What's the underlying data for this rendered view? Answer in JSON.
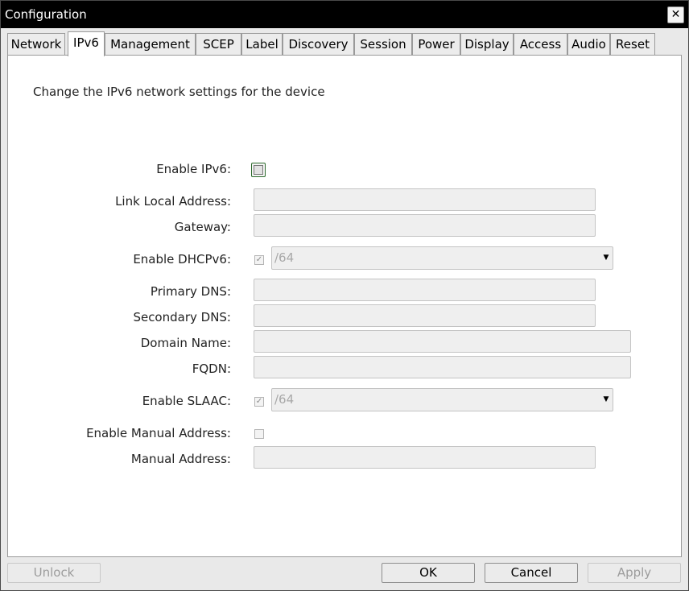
{
  "window": {
    "title": "Configuration",
    "close_glyph": "✕"
  },
  "tabs": [
    {
      "label": "Network"
    },
    {
      "label": "IPv6"
    },
    {
      "label": "Management"
    },
    {
      "label": "SCEP"
    },
    {
      "label": "Label"
    },
    {
      "label": "Discovery"
    },
    {
      "label": "Session"
    },
    {
      "label": "Power"
    },
    {
      "label": "Display"
    },
    {
      "label": "Access"
    },
    {
      "label": "Audio"
    },
    {
      "label": "Reset"
    }
  ],
  "active_tab": "IPv6",
  "panel": {
    "description": "Change the IPv6 network settings for the device",
    "enable_ipv6": {
      "label": "Enable IPv6:",
      "checked": false
    },
    "link_local_address": {
      "label": "Link Local Address:",
      "value": ""
    },
    "gateway": {
      "label": "Gateway:",
      "value": ""
    },
    "enable_dhcpv6": {
      "label": "Enable DHCPv6:",
      "checked": true,
      "checkmark": "✓",
      "prefix": "/64",
      "arrow": "▼"
    },
    "primary_dns": {
      "label": "Primary DNS:",
      "value": ""
    },
    "secondary_dns": {
      "label": "Secondary DNS:",
      "value": ""
    },
    "domain_name": {
      "label": "Domain Name:",
      "value": ""
    },
    "fqdn": {
      "label": "FQDN:",
      "value": ""
    },
    "enable_slaac": {
      "label": "Enable SLAAC:",
      "checked": true,
      "checkmark": "✓",
      "prefix": "/64",
      "arrow": "▼"
    },
    "enable_manual_address": {
      "label": "Enable Manual Address:",
      "checked": false
    },
    "manual_address": {
      "label": "Manual Address:",
      "value": ""
    }
  },
  "buttons": {
    "unlock": "Unlock",
    "ok": "OK",
    "cancel": "Cancel",
    "apply": "Apply"
  }
}
